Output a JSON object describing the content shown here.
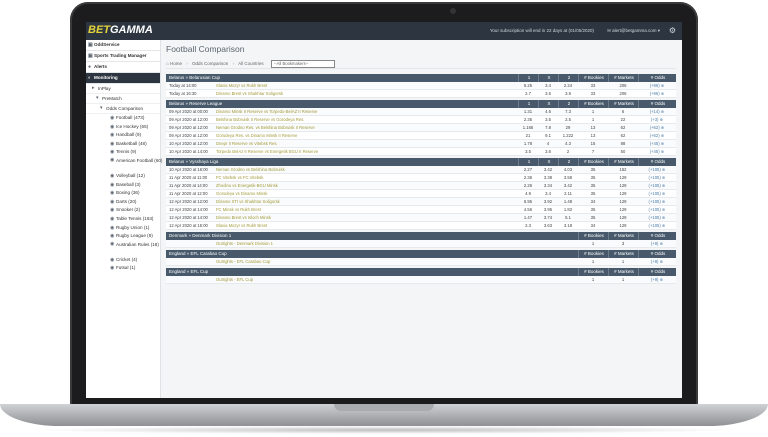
{
  "brand": {
    "part1": "BET",
    "part2": "GAMMA"
  },
  "topbar": {
    "subscription_msg": "Your subscription will end in 22 days at (01/05/2020)",
    "user_email": "✉ alert@betgamma.com ▾"
  },
  "sidebar": {
    "sections": [
      {
        "label": "OddService",
        "icon": "▣"
      },
      {
        "label": "Sports Trading Manager",
        "icon": "▣"
      },
      {
        "label": "Alerts",
        "icon": "●"
      },
      {
        "label": "Monitoring",
        "icon": "◐"
      }
    ],
    "subs": [
      {
        "label": "InPlay",
        "icon": "▸"
      },
      {
        "label": "PreMatch",
        "icon": "▾"
      },
      {
        "label": "Odds Comparison",
        "icon": "▾"
      }
    ],
    "sports": [
      "Football (473)",
      "Ice Hockey (65)",
      "Handball (9)",
      "Basketball (48)",
      "Tennis (9)",
      "American Football (60)",
      "Volleyball (12)",
      "Baseball (3)",
      "Boxing (36)",
      "Darts (20)",
      "Snooker (2)",
      "Table Tennis (163)",
      "Rugby Union (1)",
      "Rugby League (9)",
      "Australian Rules (18)",
      "Cricket (4)",
      "Futsal (1)"
    ]
  },
  "main": {
    "title": "Football Comparison",
    "breadcrumb": [
      "Home",
      "Odds Comparison",
      "All Countries"
    ],
    "bookmaker_select": "--All Bookmakers--",
    "headers": {
      "c1": "1",
      "c2": "X",
      "c3": "2",
      "c4": "# Bookies",
      "c5": "# Markets",
      "c6": "# Odds"
    },
    "leagues": [
      {
        "name": "Belarus » Belarusian Cup",
        "rows": [
          {
            "t": "Today at 14:00",
            "m": "Slavia Mozyr vs Rukh Brest",
            "o1": "5.25",
            "ox": "3.4",
            "o2": "2.24",
            "b": "33",
            "mk": "206",
            "od": "(+96)"
          },
          {
            "t": "Today at 16:30",
            "m": "Dinamo Brest vs Shakhtar Soligorsk",
            "o1": "2.7",
            "ox": "3.6",
            "o2": "3.8",
            "b": "33",
            "mk": "206",
            "od": "(+96)"
          }
        ]
      },
      {
        "name": "Belarus » Reserve League",
        "rows": [
          {
            "t": "09 Apr 2020 at 00:00",
            "m": "Dinamo Minsk II Reserve vs Torpedo-BelAZ II Reserve",
            "o1": "1.31",
            "ox": "4.6",
            "o2": "7.3",
            "b": "1",
            "mk": "6",
            "od": "(+14)"
          },
          {
            "t": "09 Apr 2020 at 12:00",
            "m": "Belshina Bobruisk II Reserve vs Gorodeya Res.",
            "o1": "2.35",
            "ox": "3.5",
            "o2": "2.5",
            "b": "1",
            "mk": "22",
            "od": "(+3)"
          },
          {
            "t": "09 Apr 2020 at 12:00",
            "m": "Neman Grodno Res. vs Belshina Bobruisk II Reserve",
            "o1": "1.166",
            "ox": "7.8",
            "o2": "29",
            "b": "13",
            "mk": "62",
            "od": "(+62)"
          },
          {
            "t": "09 Apr 2020 at 12:00",
            "m": "Gorodeya Res. vs Dinamo Minsk II Reserve",
            "o1": "21",
            "ox": "9.1",
            "o2": "1.222",
            "b": "13",
            "mk": "62",
            "od": "(+62)"
          },
          {
            "t": "10 Apr 2020 at 12:00",
            "m": "Dnepr II Reserve vs Vitebsk Res.",
            "o1": "1.78",
            "ox": "4",
            "o2": "4.3",
            "b": "15",
            "mk": "88",
            "od": "(+45)"
          },
          {
            "t": "10 Apr 2020 at 14:00",
            "m": "Torpedo BelAz II Reserve vs Energetik BGU II Reserve",
            "o1": "3.5",
            "ox": "3.6",
            "o2": "2",
            "b": "7",
            "mk": "50",
            "od": "(+45)"
          }
        ]
      },
      {
        "name": "Belarus » Vysshaya Liga",
        "rows": [
          {
            "t": "10 Apr 2020 at 16:00",
            "m": "Neman Grodno vs Belshina Bobruisk",
            "o1": "2.27",
            "ox": "3.42",
            "o2": "4.03",
            "b": "35",
            "mk": "152",
            "od": "(+105)"
          },
          {
            "t": "11 Apr 2020 at 11:00",
            "m": "FC Vitebsk vs FC Vitebsk",
            "o1": "2.36",
            "ox": "3.38",
            "o2": "3.58",
            "b": "35",
            "mk": "129",
            "od": "(+105)"
          },
          {
            "t": "11 Apr 2020 at 14:00",
            "m": "Zhodino vs Energetik-BGU Minsk",
            "o1": "2.26",
            "ox": "3.34",
            "o2": "3.42",
            "b": "35",
            "mk": "129",
            "od": "(+105)"
          },
          {
            "t": "11 Apr 2020 at 12:00",
            "m": "Gorodeya vs Dinamo Minsk",
            "o1": "4.9",
            "ox": "3.4",
            "o2": "2.11",
            "b": "35",
            "mk": "129",
            "od": "(+105)"
          },
          {
            "t": "12 Apr 2020 at 12:00",
            "m": "Dinamo STI vs Shakhtar Soligorsk",
            "o1": "6.95",
            "ox": "3.92",
            "o2": "1.48",
            "b": "34",
            "mk": "129",
            "od": "(+105)"
          },
          {
            "t": "12 Apr 2020 at 14:00",
            "m": "FC Minsk vs Rukh Brest",
            "o1": "4.56",
            "ox": "3.95",
            "o2": "1.82",
            "b": "35",
            "mk": "129",
            "od": "(+105)"
          },
          {
            "t": "12 Apr 2020 at 14:00",
            "m": "Dinamo Brest vs Isloch Minsk",
            "o1": "1.47",
            "ox": "3.74",
            "o2": "5.1",
            "b": "35",
            "mk": "129",
            "od": "(+105)"
          },
          {
            "t": "12 Apr 2020 at 15:00",
            "m": "Slavia Mozyr vs Rukh Brest",
            "o1": "2.3",
            "ox": "3.63",
            "o2": "3.18",
            "b": "34",
            "mk": "129",
            "od": "(+105)"
          }
        ]
      },
      {
        "name": "Denmark » Denmark Division 1",
        "rows": [
          {
            "t": "",
            "m": "Outrights - Denmark Division 1",
            "o1": "",
            "ox": "",
            "o2": "",
            "b": "1",
            "mk": "3",
            "od": "(+9)"
          }
        ]
      },
      {
        "name": "England » EFL Carabao Cup",
        "rows": [
          {
            "t": "",
            "m": "Outrights - EFL Carabao Cup",
            "o1": "",
            "ox": "",
            "o2": "",
            "b": "1",
            "mk": "1",
            "od": "(+8)"
          }
        ]
      },
      {
        "name": "England » EFL Cup",
        "rows": [
          {
            "t": "",
            "m": "Outrights - EFL Cup",
            "o1": "",
            "ox": "",
            "o2": "",
            "b": "1",
            "mk": "1",
            "od": "(+9)"
          }
        ]
      }
    ]
  }
}
